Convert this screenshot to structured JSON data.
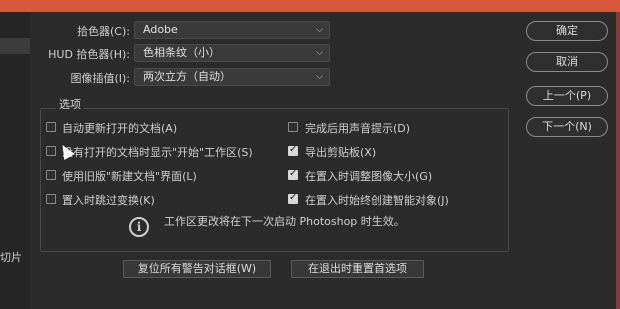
{
  "sidebar": {
    "label": "切片"
  },
  "fields": [
    {
      "label": "拾色器(C):",
      "value": "Adobe"
    },
    {
      "label": "HUD 拾色器(H):",
      "value": "色相条纹（小）"
    },
    {
      "label": "图像插值(I):",
      "value": "两次立方（自动）"
    }
  ],
  "options": {
    "title": "选项",
    "left": [
      {
        "label": "自动更新打开的文档(A)",
        "checked": false
      },
      {
        "label": "没有打开的文档时显示\"开始\"工作区(S)",
        "checked": false
      },
      {
        "label": "使用旧版\"新建文档\"界面(L)",
        "checked": false
      },
      {
        "label": "置入时跳过变换(K)",
        "checked": false
      }
    ],
    "right": [
      {
        "label": "完成后用声音提示(D)",
        "checked": false
      },
      {
        "label": "导出剪贴板(X)",
        "checked": true
      },
      {
        "label": "在置入时调整图像大小(G)",
        "checked": true
      },
      {
        "label": "在置入时始终创建智能对象(J)",
        "checked": true
      }
    ],
    "info": "工作区更改将在下一次启动 Photoshop 时生效。"
  },
  "buttons": {
    "ok": "确定",
    "cancel": "取消",
    "prev": "上一个(P)",
    "next": "下一个(N)",
    "reset_warnings": "复位所有警告对话框(W)",
    "reset_on_quit": "在退出时重置首选项"
  },
  "icons": {
    "chevron": "chevron-down-icon",
    "info": "info-icon",
    "cursor": "mouse-cursor-icon"
  }
}
